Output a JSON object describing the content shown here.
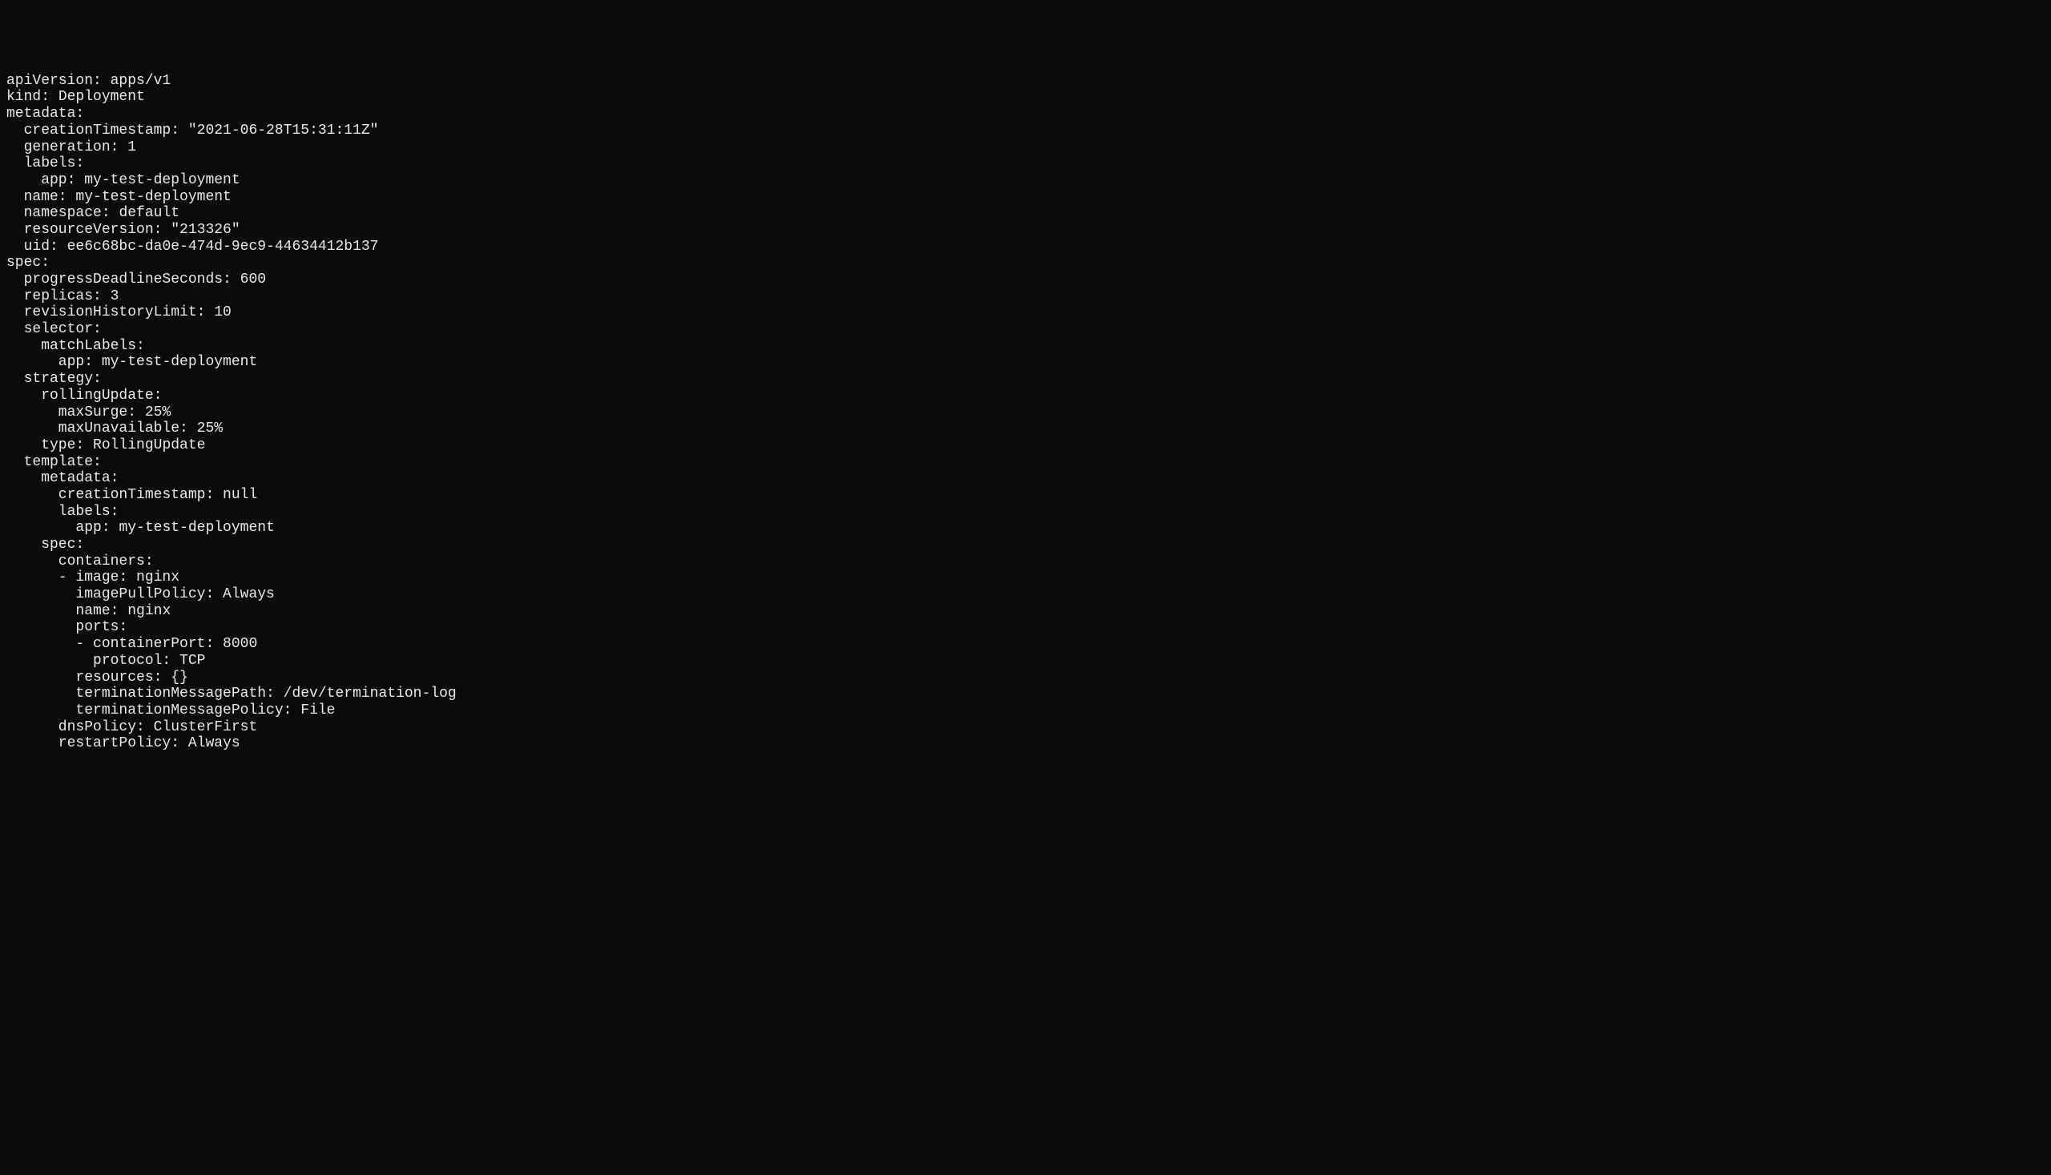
{
  "yaml": {
    "apiVersion": "apps/v1",
    "kind": "Deployment",
    "metadata": {
      "creationTimestamp": "\"2021-06-28T15:31:11Z\"",
      "generation": "1",
      "labels": {
        "app": "my-test-deployment"
      },
      "name": "my-test-deployment",
      "namespace": "default",
      "resourceVersion": "\"213326\"",
      "uid": "ee6c68bc-da0e-474d-9ec9-44634412b137"
    },
    "spec": {
      "progressDeadlineSeconds": "600",
      "replicas": "3",
      "revisionHistoryLimit": "10",
      "selector": {
        "matchLabels": {
          "app": "my-test-deployment"
        }
      },
      "strategy": {
        "rollingUpdate": {
          "maxSurge": "25%",
          "maxUnavailable": "25%"
        },
        "type": "RollingUpdate"
      },
      "template": {
        "metadata": {
          "creationTimestamp": "null",
          "labels": {
            "app": "my-test-deployment"
          }
        },
        "spec": {
          "containers": {
            "image": "nginx",
            "imagePullPolicy": "Always",
            "name": "nginx",
            "ports": {
              "containerPort": "8000",
              "protocol": "TCP"
            },
            "resources": "{}",
            "terminationMessagePath": "/dev/termination-log",
            "terminationMessagePolicy": "File"
          },
          "dnsPolicy": "ClusterFirst",
          "restartPolicy": "Always"
        }
      }
    }
  }
}
